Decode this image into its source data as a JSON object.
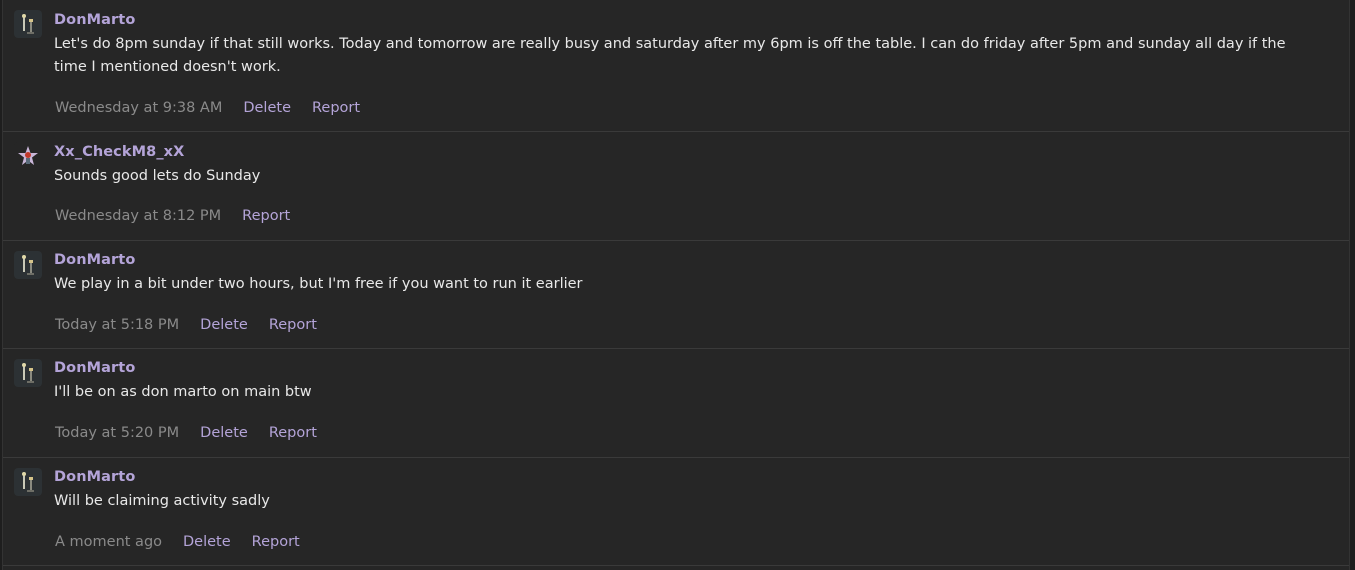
{
  "actions": {
    "delete_label": "Delete",
    "report_label": "Report"
  },
  "messages": [
    {
      "author": "DonMarto",
      "avatar": "knight-lamp-avatar",
      "body": "Let's do 8pm sunday if that still works. Today and tomorrow are really busy and saturday after my 6pm is off the table. I can do friday after 5pm and sunday all day if the time I mentioned doesn't work.",
      "timestamp": "Wednesday at 9:38 AM",
      "can_delete": true
    },
    {
      "author": "Xx_CheckM8_xX",
      "avatar": "star-figure-avatar",
      "body": "Sounds good lets do Sunday",
      "timestamp": "Wednesday at 8:12 PM",
      "can_delete": false
    },
    {
      "author": "DonMarto",
      "avatar": "knight-lamp-avatar",
      "body": "We play in a bit under two hours, but I'm free if you want to run it earlier",
      "timestamp": "Today at 5:18 PM",
      "can_delete": true
    },
    {
      "author": "DonMarto",
      "avatar": "knight-lamp-avatar",
      "body": "I'll be on as don marto on main btw",
      "timestamp": "Today at 5:20 PM",
      "can_delete": true
    },
    {
      "author": "DonMarto",
      "avatar": "knight-lamp-avatar",
      "body": "Will be claiming activity sadly",
      "timestamp": "A moment ago",
      "can_delete": true
    }
  ]
}
